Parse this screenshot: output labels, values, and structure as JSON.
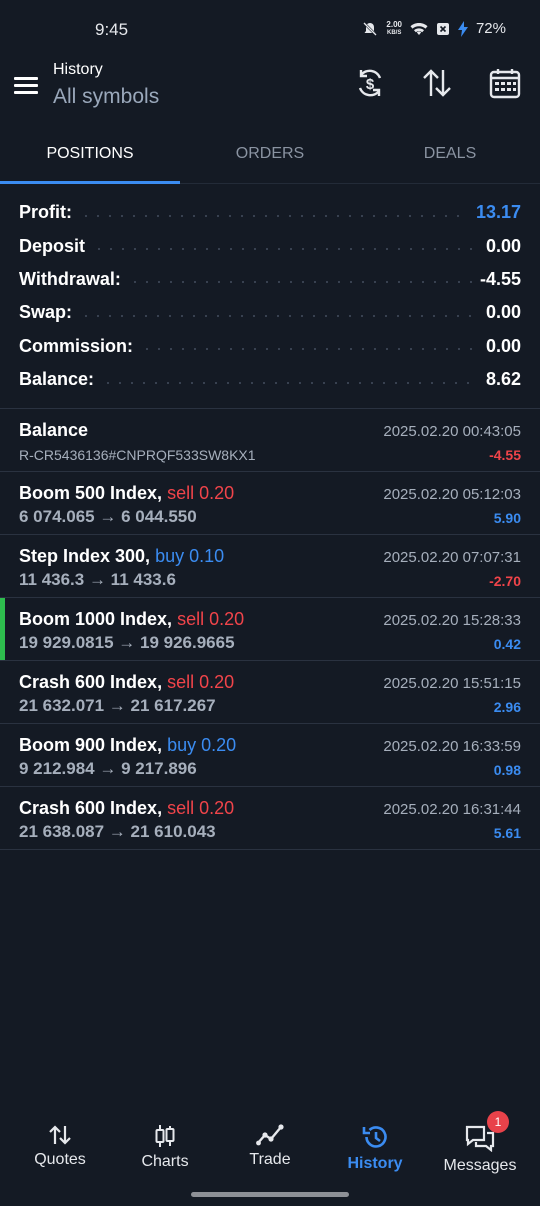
{
  "status": {
    "time": "9:45",
    "net_speed_value": "2.00",
    "net_speed_unit": "KB/S",
    "battery": "72%"
  },
  "header": {
    "title": "History",
    "subtitle": "All symbols"
  },
  "tabs": [
    {
      "label": "POSITIONS",
      "active": true
    },
    {
      "label": "ORDERS",
      "active": false
    },
    {
      "label": "DEALS",
      "active": false
    }
  ],
  "summary": [
    {
      "label": "Profit:",
      "value": "13.17",
      "color": "#3b8cf1"
    },
    {
      "label": "Deposit",
      "value": "0.00"
    },
    {
      "label": "Withdrawal:",
      "value": "-4.55"
    },
    {
      "label": "Swap:",
      "value": "0.00"
    },
    {
      "label": "Commission:",
      "value": "0.00"
    },
    {
      "label": "Balance:",
      "value": "8.62"
    }
  ],
  "positions": [
    {
      "title": "Balance",
      "side": "",
      "sub": "R-CR5436136#CNPRQF533SW8KX1",
      "date": "2025.02.20 00:43:05",
      "profit": "-4.55",
      "profit_color": "#f0444a"
    },
    {
      "title": "Boom 500 Index,",
      "side": "sell 0.20",
      "side_color": "#f0444a",
      "sub": "6 074.065 → 6 044.550",
      "date": "2025.02.20 05:12:03",
      "profit": "5.90",
      "profit_color": "#3b8cf1"
    },
    {
      "title": "Step Index 300,",
      "side": "buy 0.10",
      "side_color": "#3b8cf1",
      "sub": "11 436.3 → 11 433.6",
      "date": "2025.02.20 07:07:31",
      "profit": "-2.70",
      "profit_color": "#f0444a"
    },
    {
      "title": "Boom 1000 Index,",
      "side": "sell 0.20",
      "side_color": "#f0444a",
      "sub": "19 929.0815 → 19 926.9665",
      "date": "2025.02.20 15:28:33",
      "profit": "0.42",
      "profit_color": "#3b8cf1"
    },
    {
      "title": "Crash 600 Index,",
      "side": "sell 0.20",
      "side_color": "#f0444a",
      "sub": "21 632.071 → 21 617.267",
      "date": "2025.02.20 15:51:15",
      "profit": "2.96",
      "profit_color": "#3b8cf1"
    },
    {
      "title": "Boom 900 Index,",
      "side": "buy 0.20",
      "side_color": "#3b8cf1",
      "sub": "9 212.984 → 9 217.896",
      "date": "2025.02.20 16:33:59",
      "profit": "0.98",
      "profit_color": "#3b8cf1"
    },
    {
      "title": "Crash 600 Index,",
      "side": "sell 0.20",
      "side_color": "#f0444a",
      "sub": "21 638.087 → 21 610.043",
      "date": "2025.02.20 16:31:44",
      "profit": "5.61",
      "profit_color": "#3b8cf1"
    }
  ],
  "nav": [
    {
      "label": "Quotes",
      "icon": "quotes-arrows-icon"
    },
    {
      "label": "Charts",
      "icon": "candlestick-icon"
    },
    {
      "label": "Trade",
      "icon": "trade-line-icon"
    },
    {
      "label": "History",
      "icon": "history-clock-icon",
      "active": true
    },
    {
      "label": "Messages",
      "icon": "chat-bubbles-icon",
      "badge": "1"
    }
  ],
  "colors": {
    "background": "#141a24",
    "accent": "#3b8cf1",
    "negative": "#f0444a",
    "marker": "#2ebd4e"
  }
}
